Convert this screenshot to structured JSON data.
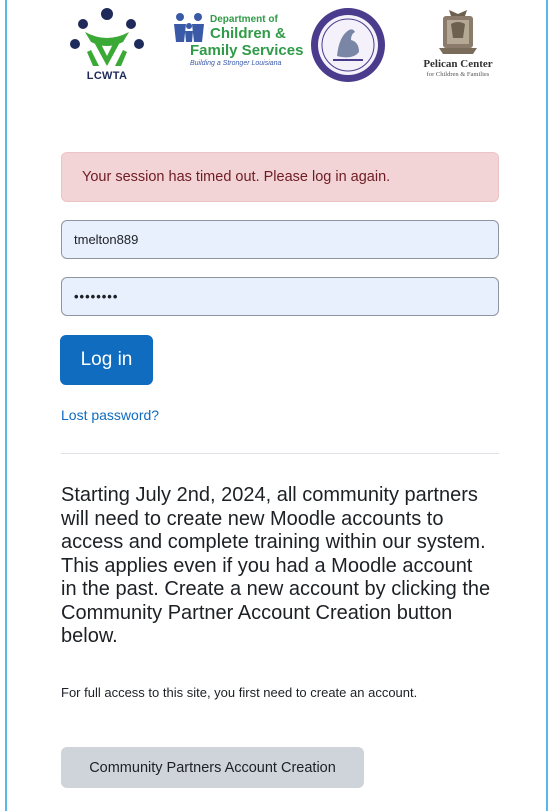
{
  "logos": {
    "lcwta": {
      "text": "LCWTA"
    },
    "dcfs": {
      "line1": "Department of",
      "line2": "Children &",
      "line3": "Family Services",
      "tagline": "Building a Stronger Louisiana"
    },
    "pelican": {
      "line1": "Pelican Center",
      "line2": "for Children & Families"
    }
  },
  "alert": {
    "message": "Your session has timed out. Please log in again."
  },
  "form": {
    "username_value": "tmelton889",
    "password_value": "••••••••",
    "login_label": "Log in",
    "lost_password_label": "Lost password?"
  },
  "notice": {
    "text": "Starting July 2nd, 2024, all community partners will need to create new Moodle accounts to access and complete training within our system. This applies even if you had a Moodle account in the past. Create a new account by clicking the Community Partner Account Creation button below."
  },
  "signup": {
    "info": "For full access to this site, you first need to create an account.",
    "button_label": "Community Partners Account Creation"
  },
  "colors": {
    "primary": "#0f6cbf",
    "alert_bg": "#f2d4d6",
    "border_accent": "#5bb8e6",
    "secondary_button": "#ced4da"
  }
}
